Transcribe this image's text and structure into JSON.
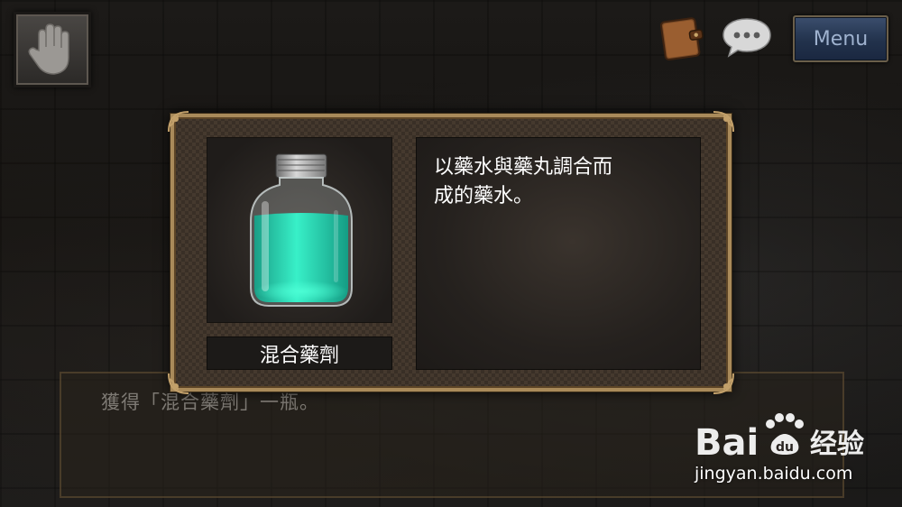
{
  "hud": {
    "hand_icon": "hand-icon",
    "journal_icon": "journal-icon",
    "chat_icon": "speech-bubble-icon",
    "menu_label": "Menu"
  },
  "item_popup": {
    "item_name": "混合藥劑",
    "item_icon": "potion-bottle-icon",
    "description": "以藥水與藥丸調合而成的藥水。",
    "description_lines": [
      "以藥水與藥丸調合而",
      "成的藥水。"
    ]
  },
  "dialogue": {
    "text": "獲得「混合藥劑」一瓶。"
  },
  "watermark": {
    "logo": "Baidu经验",
    "url": "jingyan.baidu.com"
  },
  "colors": {
    "frame_gold": "#a98a5a",
    "potion_green": "#2fe0b8",
    "menu_blue": "#22324c"
  }
}
